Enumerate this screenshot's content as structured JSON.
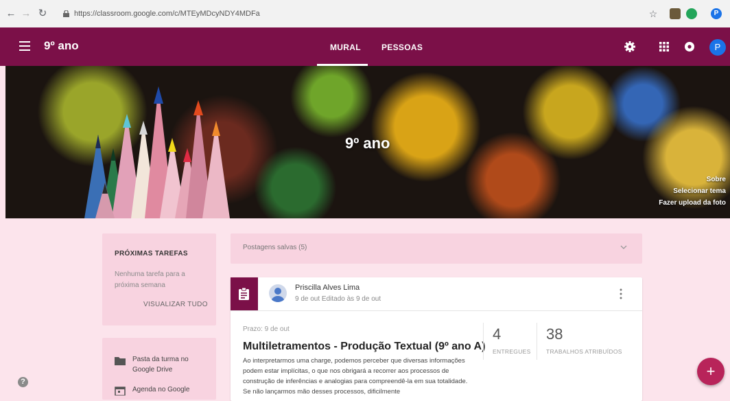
{
  "browser": {
    "url": "https://classroom.google.com/c/MTEyMDcyNDY4MDFa",
    "back_icon": "arrow-left",
    "forward_icon": "arrow-right",
    "reload_icon": "reload",
    "star_icon": "star-outline",
    "profile_letter": "P"
  },
  "appbar": {
    "title": "9º ano",
    "tabs": [
      {
        "label": "MURAL",
        "active": true
      },
      {
        "label": "PESSOAS",
        "active": false
      }
    ],
    "avatar_letter": "P",
    "color": "#7b1048"
  },
  "banner": {
    "title": "9º ano",
    "links": [
      "Sobre",
      "Selecionar tema",
      "Fazer upload da foto"
    ]
  },
  "upcoming": {
    "title": "PRÓXIMAS TAREFAS",
    "empty_text": "Nenhuma tarefa para a próxima semana",
    "view_all": "VISUALIZAR TUDO"
  },
  "links": [
    {
      "label": "Pasta da turma no Google Drive",
      "icon": "folder-icon"
    },
    {
      "label": "Agenda no Google",
      "icon": "calendar-icon"
    }
  ],
  "saved_posts": {
    "label": "Postagens salvas (5)"
  },
  "post": {
    "author": "Priscilla Alves Lima",
    "meta": "9 de out Editado às 9 de out",
    "due": "Prazo: 9 de out",
    "title": "Multiletramentos - Produção Textual (9º ano A)",
    "body": "Ao interpretarmos uma charge, podemos perceber que diversas informações podem estar implícitas, o que nos obrigará a recorrer aos processos de construção de inferências e analogias para compreendê-la em sua totalidade. Se não lançarmos mão desses processos, dificilmente",
    "stats": [
      {
        "value": "4",
        "label": "ENTREGUES"
      },
      {
        "value": "38",
        "label": "TRABALHOS ATRIBUÍDOS"
      }
    ]
  },
  "fab_label": "+",
  "help_label": "?"
}
